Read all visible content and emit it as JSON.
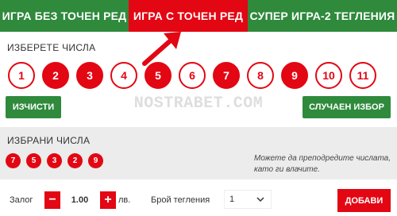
{
  "tabs": [
    {
      "label": "ИГРА БЕЗ ТОЧЕН РЕД",
      "active": false
    },
    {
      "label": "ИГРА С ТОЧЕН РЕД",
      "active": true
    },
    {
      "label": "СУПЕР ИГРА-2 ТЕГЛЕНИЯ",
      "active": false
    }
  ],
  "choose": {
    "label": "ИЗБЕРЕТЕ ЧИСЛА",
    "numbers": [
      {
        "n": "1",
        "selected": false
      },
      {
        "n": "2",
        "selected": true
      },
      {
        "n": "3",
        "selected": true
      },
      {
        "n": "4",
        "selected": false
      },
      {
        "n": "5",
        "selected": true
      },
      {
        "n": "6",
        "selected": false
      },
      {
        "n": "7",
        "selected": true
      },
      {
        "n": "8",
        "selected": false
      },
      {
        "n": "9",
        "selected": true
      },
      {
        "n": "10",
        "selected": false
      },
      {
        "n": "11",
        "selected": false
      }
    ],
    "clear_label": "ИЗЧИСТИ",
    "random_label": "СЛУЧАЕН ИЗБОР"
  },
  "watermark": "NOSTRABET.COM",
  "chosen": {
    "label": "ИЗБРАНИ ЧИСЛА",
    "balls": [
      "7",
      "5",
      "3",
      "2",
      "9"
    ],
    "hint": "Можете да преподредите числата, като ги влачите."
  },
  "bottom": {
    "stake_label": "Залог",
    "stake_value": "1.00",
    "minus_label": "−",
    "plus_label": "+",
    "currency": "лв.",
    "draws_label": "Брой тегления",
    "draws_value": "1",
    "add_label": "ДОБАВИ"
  },
  "colors": {
    "red": "#e30613",
    "green": "#2f8a3c",
    "panel": "#ececec"
  }
}
